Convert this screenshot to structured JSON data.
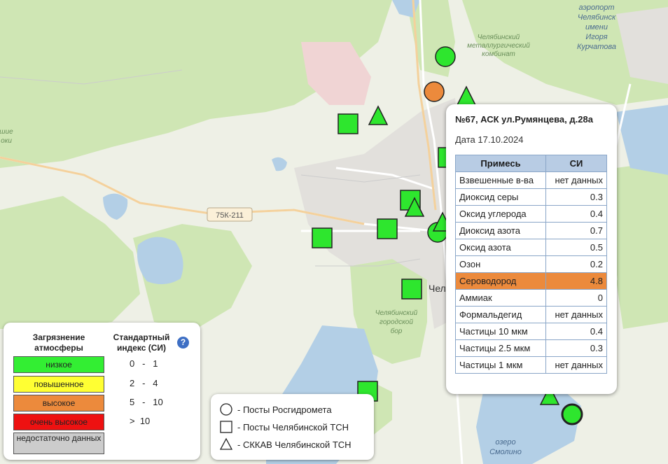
{
  "map": {
    "labels": {
      "airport": [
        "аэропорт",
        "Челябинск",
        "имени",
        "Игоря",
        "Курчатова"
      ],
      "plant": [
        "Челябинский",
        "металлургический",
        "комбинат"
      ],
      "forest": [
        "Челябинский",
        "городской",
        "бор"
      ],
      "lake": [
        "озеро",
        "Смолино"
      ],
      "road": "75К-211",
      "city": "Чел",
      "left_edge": [
        "шие",
        "оки"
      ]
    },
    "colors": {
      "low": "#2ee62e",
      "high": "#ec8a3c",
      "water": "#b4d0e8",
      "forest": "#c8e4a8",
      "urban": "#e4e2de"
    },
    "markers": [
      {
        "shape": "circle",
        "level": "low"
      },
      {
        "shape": "circle",
        "level": "high"
      },
      {
        "shape": "triangle",
        "level": "low"
      },
      {
        "shape": "square",
        "level": "low"
      },
      {
        "shape": "triangle",
        "level": "low"
      },
      {
        "shape": "square",
        "level": "low"
      },
      {
        "shape": "square",
        "level": "low"
      },
      {
        "shape": "triangle",
        "level": "low"
      },
      {
        "shape": "square",
        "level": "low"
      },
      {
        "shape": "square",
        "level": "low"
      },
      {
        "shape": "circle",
        "level": "low"
      },
      {
        "shape": "triangle",
        "level": "low"
      },
      {
        "shape": "square",
        "level": "low"
      },
      {
        "shape": "square",
        "level": "low"
      },
      {
        "shape": "triangle",
        "level": "low"
      },
      {
        "shape": "circle",
        "level": "low"
      }
    ]
  },
  "popup": {
    "title": "№67, АСК ул.Румянцева, д.28а",
    "date": "Дата 17.10.2024",
    "headers": [
      "Примесь",
      "СИ"
    ],
    "rows": [
      {
        "name": "Взвешенные в-ва",
        "value": "нет данных"
      },
      {
        "name": "Диоксид серы",
        "value": "0.3"
      },
      {
        "name": "Оксид углерода",
        "value": "0.4"
      },
      {
        "name": "Диоксид азота",
        "value": "0.7"
      },
      {
        "name": "Оксид азота",
        "value": "0.5"
      },
      {
        "name": "Озон",
        "value": "0.2"
      },
      {
        "name": "Сероводород",
        "value": "4.8",
        "highlight": true
      },
      {
        "name": "Аммиак",
        "value": "0"
      },
      {
        "name": "Формальдегид",
        "value": "нет данных"
      },
      {
        "name": "Частицы 10 мкм",
        "value": "0.4"
      },
      {
        "name": "Частицы 2.5 мкм",
        "value": "0.3"
      },
      {
        "name": "Частицы 1 мкм",
        "value": "нет данных"
      }
    ]
  },
  "legend": {
    "col1_title": "Загрязнение атмосферы",
    "col2_title": "Стандартный индекс (СИ)",
    "help_icon": "question-icon",
    "levels": [
      {
        "label": "низкое",
        "color": "#33ee33",
        "range": "0   -   1"
      },
      {
        "label": "повышенное",
        "color": "#ffff33",
        "range": "2   -   4"
      },
      {
        "label": "высокое",
        "color": "#ec8a3c",
        "range": "5   -   10"
      },
      {
        "label": "очень высокое",
        "color": "#ee1111",
        "range": ">  10"
      },
      {
        "label": "недостаточно данных",
        "color": "#cccccc",
        "range": ""
      }
    ]
  },
  "symbols": {
    "items": [
      {
        "icon": "circle-icon",
        "label": "- Посты Росгидромета"
      },
      {
        "icon": "square-icon",
        "label": "- Посты Челябинской ТСН"
      },
      {
        "icon": "triangle-icon",
        "label": "- СККАВ Челябинской ТСН"
      }
    ]
  }
}
